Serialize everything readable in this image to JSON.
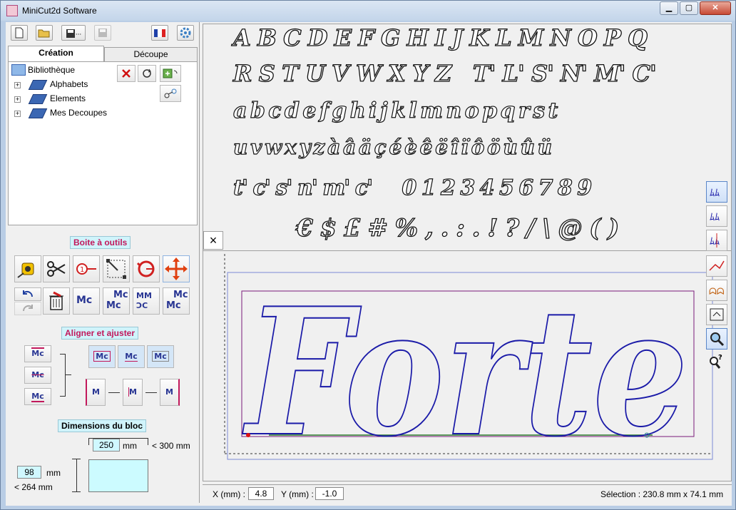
{
  "window": {
    "title": "MiniCut2d Software",
    "minimize_label": "▁",
    "maximize_label": "▢",
    "close_label": "✕"
  },
  "toolbar": {
    "new_icon": "document-icon",
    "open_icon": "folder-open-icon",
    "saveas_label": "...",
    "language_icon": "french-flag-icon",
    "settings_icon": "gear-icon"
  },
  "tabs": [
    {
      "label": "Création",
      "active": true
    },
    {
      "label": "Découpe",
      "active": false
    }
  ],
  "tree": {
    "root": "Bibliothèque",
    "items": [
      "Alphabets",
      "Elements",
      "Mes Decoupes"
    ]
  },
  "toolbox": {
    "title": "Boite à outils",
    "align_title": "Aligner et ajuster",
    "dimensions_title": "Dimensions du bloc",
    "mc_text": "Mc"
  },
  "dimensions": {
    "width_value": "250",
    "width_unit": "mm",
    "width_max": "< 300 mm",
    "height_value": "98",
    "height_unit": "mm",
    "height_max": "< 264 mm"
  },
  "glyph_palette": {
    "rows": [
      "A B C D E F G H I J K L M N O P Q",
      "R S T U V W X Y Z   T' L' S' N' M' C'",
      "a b c d e f g h i j k l m n o p q r s t",
      "u v w x y z à â ä ç é è ê ë î ï ô ö ù û ü",
      "t' c' s' n' m' c'     0 1 2 3 4 5 6 7 8 9",
      "€ $ £ # % , . : . ! ? / \\ @ ( )"
    ],
    "close_label": "×"
  },
  "canvas": {
    "text": "Forte",
    "stroke_color": "#1a1aa8",
    "box_color": "#7a1a7a"
  },
  "status": {
    "x_label": "X (mm) :",
    "x_value": "4.8",
    "y_label": "Y (mm) :",
    "y_value": "-1.0",
    "selection": "Sélection : 230.8 mm x 74.1 mm"
  }
}
